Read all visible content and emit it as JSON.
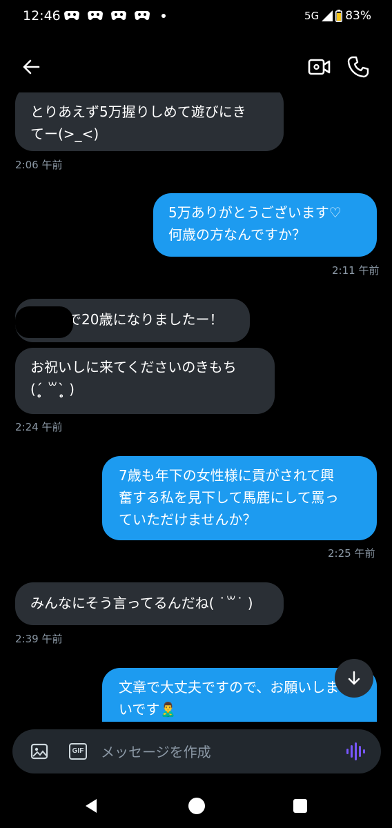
{
  "status_bar": {
    "time": "12:46",
    "network": "5G",
    "battery": "83%"
  },
  "header": {
    "icons": [
      "back-arrow-icon",
      "video-call-icon",
      "phone-icon"
    ]
  },
  "messages": [
    {
      "direction": "received",
      "text": "とりあえず5万握りしめて遊びにき\nてー(>_<)",
      "time": "2:06 午前"
    },
    {
      "direction": "sent",
      "text": "5万ありがとうございます♡\n何歳の方なんですか？",
      "time": "2:11 午前"
    },
    {
      "direction": "received",
      "text": "で20歳になりましたー！"
    },
    {
      "direction": "received",
      "text": "お祝いしに来てくださいのきもち\n(ˊ̥̥̥̥̥ ꒳ˋ̥̥̥̥̥ )",
      "time": "2:24 午前"
    },
    {
      "direction": "sent",
      "text": "7歳も年下の女性様に貢がされて興\n奮する私を見下して馬鹿にして罵っ\nていただけませんか？",
      "time": "2:25 午前"
    },
    {
      "direction": "received",
      "text": "みんなにそう言ってるんだね( ˙꒳˙ )",
      "time": "2:39 午前"
    },
    {
      "direction": "sent",
      "text": "文章で大丈夫ですので、お願いしま\nいです🙎‍♂️"
    }
  ],
  "composer": {
    "placeholder": "メッセージを作成",
    "gif_label": "GIF"
  },
  "colors": {
    "background": "#000000",
    "received_bubble": "#2a2f35",
    "sent_bubble": "#1d9bf0",
    "timestamp": "#8b98a5",
    "voice_accent": "#7856ff"
  }
}
